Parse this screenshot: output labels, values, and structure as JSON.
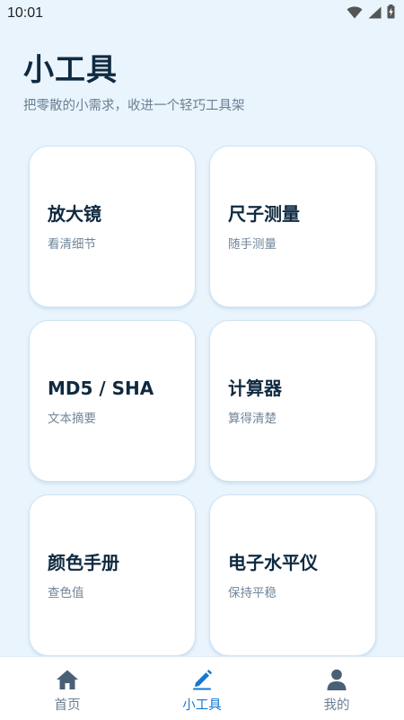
{
  "status_bar": {
    "time": "10:01",
    "icons": [
      "wifi-icon",
      "cellular-signal-icon",
      "battery-charging-icon"
    ]
  },
  "header": {
    "title": "小工具",
    "subtitle": "把零散的小需求，收进一个轻巧工具架"
  },
  "tools": [
    {
      "title": "放大镜",
      "desc": "看清细节"
    },
    {
      "title": "尺子测量",
      "desc": "随手测量"
    },
    {
      "title": "MD5 / SHA",
      "desc": "文本摘要"
    },
    {
      "title": "计算器",
      "desc": "算得清楚"
    },
    {
      "title": "颜色手册",
      "desc": "查色值"
    },
    {
      "title": "电子水平仪",
      "desc": "保持平稳"
    }
  ],
  "bottom_nav": {
    "items": [
      {
        "label": "首页",
        "icon": "home-icon",
        "active": false
      },
      {
        "label": "小工具",
        "icon": "edit-pencil-icon",
        "active": true
      },
      {
        "label": "我的",
        "icon": "user-icon",
        "active": false
      }
    ]
  },
  "colors": {
    "background": "#e9f4fd",
    "accent": "#1477d4",
    "inactive": "#6a7f91",
    "title": "#0f2a40",
    "card": "#ffffff"
  }
}
